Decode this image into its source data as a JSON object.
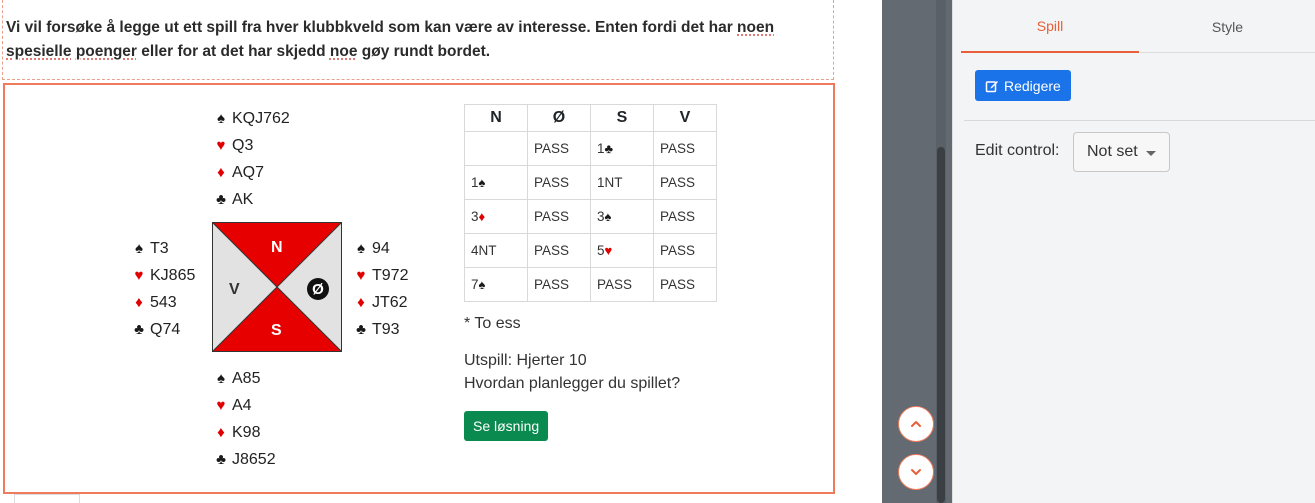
{
  "intro": {
    "p1": "Vi vil forsøke å legge ut ett spill fra hver klubbkveld som kan være av interesse. Enten fordi det har ",
    "w1": "noen",
    "p2": " ",
    "w2": "spesielle",
    "p3": " ",
    "w3": "poenger",
    "p4": " eller for at det har skjedd ",
    "w4": "noe",
    "p5": " gøy rundt bordet."
  },
  "hands": {
    "north": {
      "spades": "KQJ762",
      "hearts": "Q3",
      "diamonds": "AQ7",
      "clubs": "AK"
    },
    "west": {
      "spades": "T3",
      "hearts": "KJ865",
      "diamonds": "543",
      "clubs": "Q74"
    },
    "east": {
      "spades": "94",
      "hearts": "T972",
      "diamonds": "JT62",
      "clubs": "T93"
    },
    "south": {
      "spades": "A85",
      "hearts": "A4",
      "diamonds": "K98",
      "clubs": "J8652"
    }
  },
  "suits": {
    "spades": "♠",
    "hearts": "♥",
    "diamonds": "♦",
    "clubs": "♣"
  },
  "compass": {
    "north": "N",
    "south": "S",
    "west": "V",
    "east": "Ø",
    "vul_color": "#e60000",
    "nonvul_color": "#e2e2e2"
  },
  "bidding": {
    "headers": [
      "N",
      "Ø",
      "S",
      "V"
    ],
    "rows": [
      [
        {
          "text": ""
        },
        {
          "text": "PASS"
        },
        {
          "text": "1",
          "suit": "♣",
          "color": "black"
        },
        {
          "text": "PASS"
        }
      ],
      [
        {
          "text": "1",
          "suit": "♠",
          "color": "black"
        },
        {
          "text": "PASS"
        },
        {
          "text": "1NT"
        },
        {
          "text": "PASS"
        }
      ],
      [
        {
          "text": "3",
          "suit": "♦",
          "color": "red"
        },
        {
          "text": "PASS"
        },
        {
          "text": "3",
          "suit": "♠",
          "color": "black"
        },
        {
          "text": "PASS"
        }
      ],
      [
        {
          "text": "4NT"
        },
        {
          "text": "PASS"
        },
        {
          "text": "5",
          "suit": "♥",
          "color": "red"
        },
        {
          "text": "PASS"
        }
      ],
      [
        {
          "text": "7",
          "suit": "♠",
          "color": "black"
        },
        {
          "text": "PASS"
        },
        {
          "text": "PASS"
        },
        {
          "text": "PASS"
        }
      ]
    ]
  },
  "note": "* To ess",
  "lead": "Utspill: Hjerter 10",
  "question": "Hvordan planlegger du spillet?",
  "solution_button": "Se løsning",
  "panel": {
    "tabs": [
      "Spill",
      "Style"
    ],
    "edit_button": "Redigere",
    "edit_control_label": "Edit control:",
    "edit_control_value": "Not set"
  },
  "colors": {
    "accent": "#e8603a",
    "primary": "#1a73e8",
    "success": "#0a8a4f",
    "red_suit": "#e00000"
  }
}
